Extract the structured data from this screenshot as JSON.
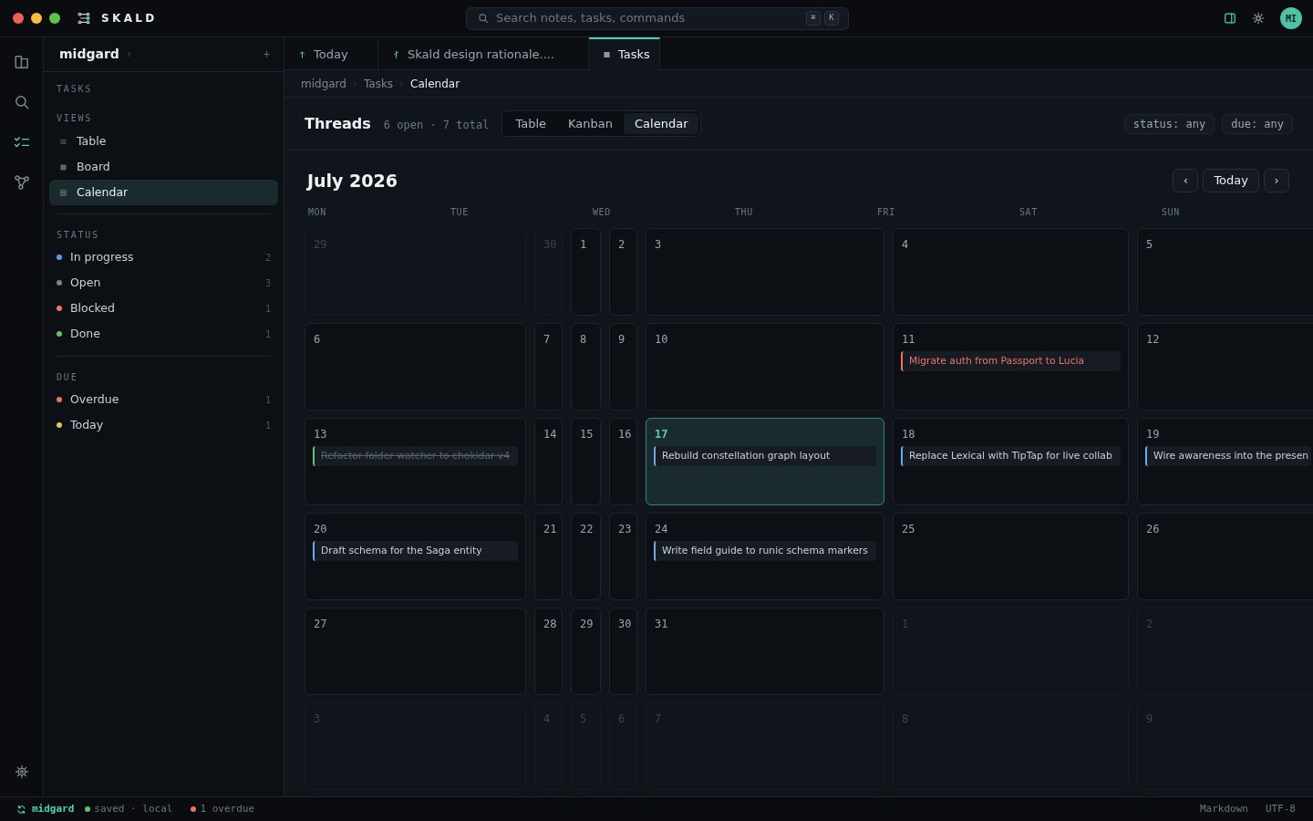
{
  "app": {
    "name": "SKALD"
  },
  "search": {
    "placeholder": "Search notes, tasks, commands",
    "keys": [
      "⌘",
      "K"
    ]
  },
  "user": {
    "initials": "MI"
  },
  "rail": [
    {
      "kind": "files",
      "selected": false
    },
    {
      "kind": "search",
      "selected": false
    },
    {
      "kind": "tasks",
      "selected": true
    },
    {
      "kind": "graph",
      "selected": false
    }
  ],
  "sidebar": {
    "vault": "midgard",
    "section": "TASKS",
    "views_heading": "VIEWS",
    "views": [
      {
        "kind": "table",
        "label": "Table",
        "selected": false
      },
      {
        "kind": "board",
        "label": "Board",
        "selected": false
      },
      {
        "kind": "calendar",
        "label": "Calendar",
        "selected": true
      }
    ],
    "status_heading": "STATUS",
    "status": [
      {
        "label": "In progress",
        "count": "2",
        "color": "#5b9cf0"
      },
      {
        "label": "Open",
        "count": "3",
        "color": "#7d8590"
      },
      {
        "label": "Blocked",
        "count": "1",
        "color": "#f07560"
      },
      {
        "label": "Done",
        "count": "1",
        "color": "#5fc26a"
      }
    ],
    "due_heading": "DUE",
    "due": [
      {
        "label": "Overdue",
        "count": "1",
        "color": "#f07560"
      },
      {
        "label": "Today",
        "count": "1",
        "color": "#e8c35a"
      }
    ]
  },
  "tabs": [
    {
      "kind": "today",
      "label": "Today",
      "selected": false
    },
    {
      "kind": "note",
      "label": "Skald design rationale....",
      "selected": false
    },
    {
      "kind": "tasks",
      "label": "Tasks",
      "selected": true
    }
  ],
  "breadcrumb": [
    "midgard",
    "Tasks",
    "Calendar"
  ],
  "header": {
    "title": "Threads",
    "summary": "6 open · 7 total",
    "views": [
      {
        "label": "Table",
        "selected": false
      },
      {
        "label": "Kanban",
        "selected": false
      },
      {
        "label": "Calendar",
        "selected": true
      }
    ],
    "filters": [
      "status: any",
      "due: any"
    ]
  },
  "calendar": {
    "month": "July 2026",
    "prev": "‹",
    "today_button": "Today",
    "next": "›",
    "weekdays": [
      "MON",
      "TUE",
      "WED",
      "THU",
      "FRI",
      "SAT",
      "SUN"
    ],
    "weeks": [
      [
        {
          "day": "29",
          "outside": true,
          "today": false
        },
        {
          "day": "30",
          "outside": true,
          "today": false
        },
        {
          "day": "1",
          "outside": false,
          "today": false
        },
        {
          "day": "2",
          "outside": false,
          "today": false
        },
        {
          "day": "3",
          "outside": false,
          "today": false
        },
        {
          "day": "4",
          "outside": false,
          "today": false
        },
        {
          "day": "5",
          "outside": false,
          "today": false
        }
      ],
      [
        {
          "day": "6",
          "outside": false,
          "today": false
        },
        {
          "day": "7",
          "outside": false,
          "today": false
        },
        {
          "day": "8",
          "outside": false,
          "today": false
        },
        {
          "day": "9",
          "outside": false,
          "today": false
        },
        {
          "day": "10",
          "outside": false,
          "today": false
        },
        {
          "day": "11",
          "outside": false,
          "today": false,
          "events": [
            {
              "kind": "blocked",
              "title": "Migrate auth from Passport to Lucia"
            }
          ]
        },
        {
          "day": "12",
          "outside": false,
          "today": false
        }
      ],
      [
        {
          "day": "13",
          "outside": false,
          "today": false,
          "events": [
            {
              "kind": "done",
              "title": "Refactor folder watcher to chokidar v4"
            }
          ]
        },
        {
          "day": "14",
          "outside": false,
          "today": false
        },
        {
          "day": "15",
          "outside": false,
          "today": false
        },
        {
          "day": "16",
          "outside": false,
          "today": false
        },
        {
          "day": "17",
          "outside": false,
          "today": true,
          "events": [
            {
              "kind": "active",
              "title": "Rebuild constellation graph layout"
            }
          ]
        },
        {
          "day": "18",
          "outside": false,
          "today": false,
          "events": [
            {
              "kind": "active",
              "title": "Replace Lexical with TipTap for live collab"
            }
          ]
        },
        {
          "day": "19",
          "outside": false,
          "today": false,
          "events": [
            {
              "kind": "active",
              "title": "Wire awareness into the presen"
            }
          ]
        }
      ],
      [
        {
          "day": "20",
          "outside": false,
          "today": false,
          "events": [
            {
              "kind": "active",
              "title": "Draft schema for the Saga entity"
            }
          ]
        },
        {
          "day": "21",
          "outside": false,
          "today": false
        },
        {
          "day": "22",
          "outside": false,
          "today": false
        },
        {
          "day": "23",
          "outside": false,
          "today": false
        },
        {
          "day": "24",
          "outside": false,
          "today": false,
          "events": [
            {
              "kind": "active",
              "title": "Write field guide to runic schema markers"
            }
          ]
        },
        {
          "day": "25",
          "outside": false,
          "today": false
        },
        {
          "day": "26",
          "outside": false,
          "today": false
        }
      ],
      [
        {
          "day": "27",
          "outside": false,
          "today": false
        },
        {
          "day": "28",
          "outside": false,
          "today": false
        },
        {
          "day": "29",
          "outside": false,
          "today": false
        },
        {
          "day": "30",
          "outside": false,
          "today": false
        },
        {
          "day": "31",
          "outside": false,
          "today": false
        },
        {
          "day": "1",
          "outside": true,
          "today": false
        },
        {
          "day": "2",
          "outside": true,
          "today": false
        }
      ],
      [
        {
          "day": "3",
          "outside": true,
          "today": false
        },
        {
          "day": "4",
          "outside": true,
          "today": false
        },
        {
          "day": "5",
          "outside": true,
          "today": false
        },
        {
          "day": "6",
          "outside": true,
          "today": false
        },
        {
          "day": "7",
          "outside": true,
          "today": false
        },
        {
          "day": "8",
          "outside": true,
          "today": false
        },
        {
          "day": "9",
          "outside": true,
          "today": false
        }
      ]
    ]
  },
  "status_bar": {
    "vault": "midgard",
    "sync_state": "saved · local",
    "overdue": "1 overdue",
    "format": "Markdown",
    "encoding": "UTF-8"
  }
}
